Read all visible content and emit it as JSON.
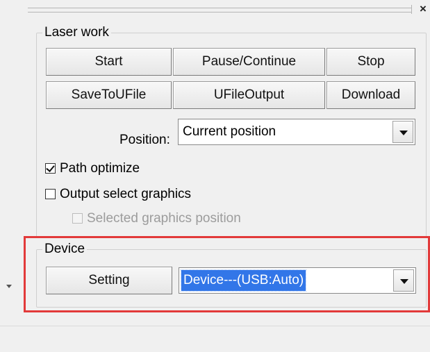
{
  "panel": {
    "close_glyph": "×"
  },
  "laser_work": {
    "group_label": "Laser work",
    "buttons": {
      "start": "Start",
      "pause_continue": "Pause/Continue",
      "stop": "Stop",
      "save_to_ufile": "SaveToUFile",
      "ufile_output": "UFileOutput",
      "download": "Download"
    },
    "position_label": "Position:",
    "position_value": "Current position",
    "path_optimize": {
      "label": "Path optimize",
      "checked": true
    },
    "output_select_graphics": {
      "label": "Output select graphics",
      "checked": false
    },
    "selected_graphics_position": {
      "label": "Selected graphics position",
      "checked": false,
      "enabled": false
    }
  },
  "device": {
    "group_label": "Device",
    "setting_button": "Setting",
    "device_value": "Device---(USB:Auto)"
  },
  "colors": {
    "highlight_border": "#e23a3a",
    "selection_bg": "#3276e8"
  }
}
